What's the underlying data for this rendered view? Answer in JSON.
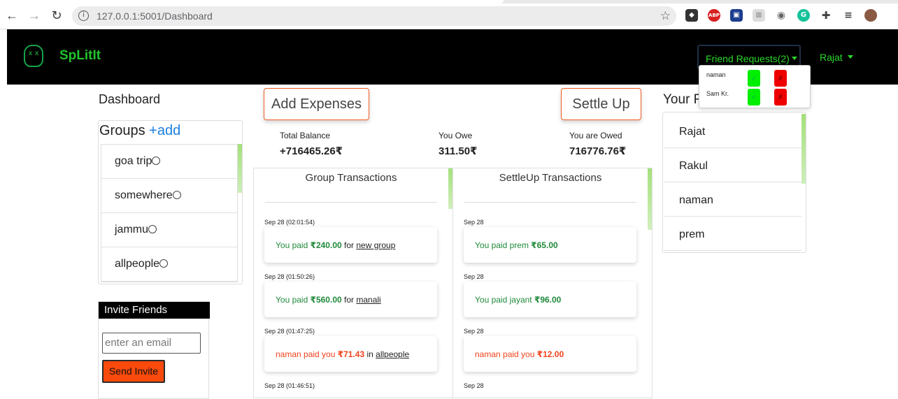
{
  "browser": {
    "url": "127.0.0.1:5001/Dashboard"
  },
  "navbar": {
    "brand": "SpLitIt",
    "friend_requests_label": "Friend Requests(2)",
    "user_label": "Rajat",
    "friend_requests": [
      {
        "name": "naman",
        "accept": "✓",
        "reject": "✗"
      },
      {
        "name": "Sam Kr.",
        "accept": "✓",
        "reject": "✗"
      }
    ]
  },
  "sidebar": {
    "dashboard_title": "Dashboard",
    "groups_title": "Groups",
    "groups_add": "+add",
    "groups": [
      "goa trip",
      "somewhere",
      "jammu",
      "allpeople"
    ],
    "invite_title": "Invite Friends",
    "invite_placeholder": "enter an email",
    "invite_button": "Send Invite"
  },
  "actions": {
    "add_expenses": "Add Expenses",
    "settle_up": "Settle Up"
  },
  "balances": {
    "total_label": "Total Balance",
    "total_value": "+716465.26₹",
    "owe_label": "You Owe",
    "owe_value": "311.50₹",
    "owed_label": "You are Owed",
    "owed_value": "716776.76₹"
  },
  "group_transactions": {
    "title": "Group Transactions",
    "items": [
      {
        "date": "Sep 28 (02:01:54)",
        "prefix": "You paid ",
        "amount": "₹240.00",
        "mid": " for ",
        "group": "new group"
      },
      {
        "date": "Sep 28 (01:50:26)",
        "prefix": "You paid ",
        "amount": "₹560.00",
        "mid": " for ",
        "group": "manali"
      },
      {
        "date": "Sep 28 (01:47:25)",
        "prefix": "naman paid you ",
        "amount": "₹71.43",
        "mid": " in ",
        "group": "allpeople"
      },
      {
        "date": "Sep 28 (01:46:51)"
      }
    ]
  },
  "settle_transactions": {
    "title": "SettleUp Transactions",
    "items": [
      {
        "date": "Sep 28",
        "prefix": "You paid prem ",
        "amount": "₹65.00"
      },
      {
        "date": "Sep 28",
        "prefix": "You paid jayant ",
        "amount": "₹96.00"
      },
      {
        "date": "Sep 28",
        "prefix": "naman paid you ",
        "amount": "₹12.00"
      },
      {
        "date": "Sep 28"
      }
    ]
  },
  "friends": {
    "title": "Your F",
    "items": [
      "Rajat",
      "Rakul",
      "naman",
      "prem"
    ]
  },
  "colors": {
    "brand_green": "#22c32e",
    "accent_orange": "#f05d23",
    "paid_green": "#1f8a3a",
    "received_red": "#f2421b",
    "link_blue": "#1a7fe0"
  }
}
